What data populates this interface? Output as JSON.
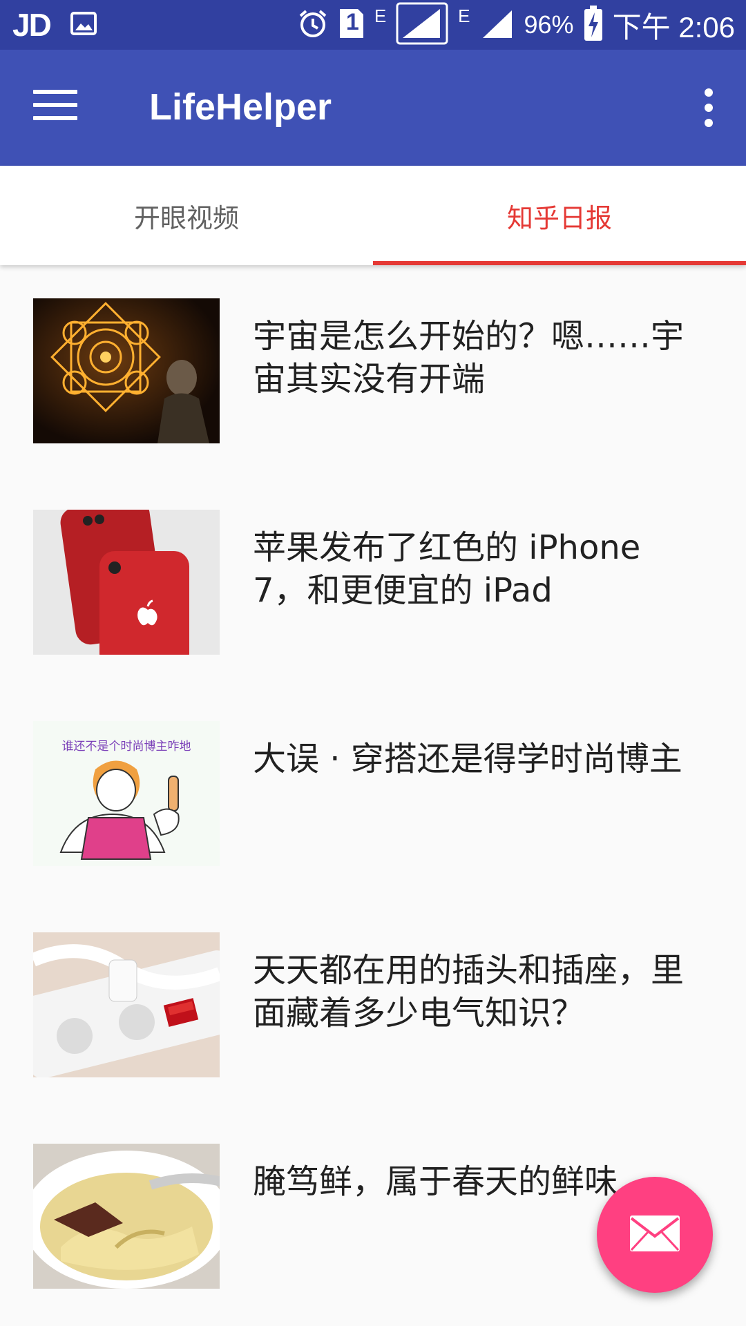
{
  "status_bar": {
    "carrier_logo": "JD",
    "alarm_icon": "alarm-icon",
    "sim_label": "1",
    "net_type_1": "E",
    "net_type_2": "E",
    "battery": "96%",
    "time": "下午 2:06"
  },
  "app_bar": {
    "title": "LifeHelper",
    "menu_icon": "hamburger-menu-icon",
    "overflow_icon": "more-vert-icon"
  },
  "tabs": [
    {
      "label": "开眼视频",
      "selected": false
    },
    {
      "label": "知乎日报",
      "selected": true
    }
  ],
  "colors": {
    "status_bar": "#3140a0",
    "app_bar": "#3f51b5",
    "tab_accent": "#e53935",
    "fab": "#ff4081",
    "background": "#fafafa"
  },
  "articles": [
    {
      "title": "宇宙是怎么开始的？嗯……宇宙其实没有开端",
      "thumbnail": "glowing-mandala-scene"
    },
    {
      "title": "苹果发布了红色的 iPhone 7，和更便宜的 iPad",
      "thumbnail": "red-iphone-photo"
    },
    {
      "title": "大误 · 穿搭还是得学时尚博主",
      "thumbnail": "cartoon-fashion-drawing",
      "thumbnail_caption": "谁还不是个时尚博主咋地"
    },
    {
      "title": "天天都在用的插头和插座，里面藏着多少电气知识？",
      "thumbnail": "power-strip-photo"
    },
    {
      "title": "腌笃鲜，属于春天的鲜味",
      "thumbnail": "soup-bowl-photo"
    }
  ],
  "fab": {
    "icon": "mail-icon"
  }
}
